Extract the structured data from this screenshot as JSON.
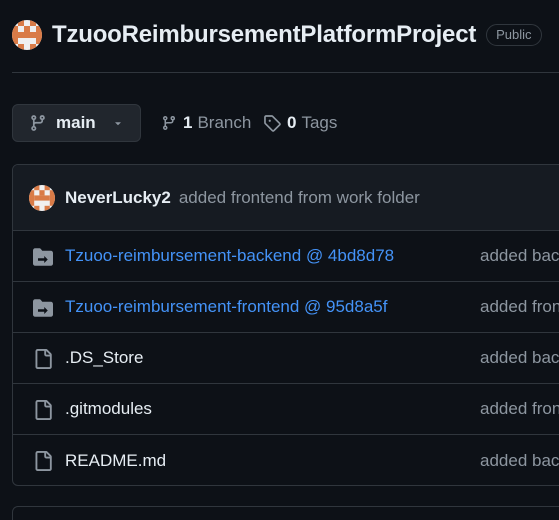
{
  "repo": {
    "name": "TzuooReimbursementPlatformProject",
    "visibility": "Public",
    "avatar_icon": "identicon-avatar"
  },
  "toolbar": {
    "branch_label": "main",
    "branch_count": "1",
    "branch_word": "Branch",
    "tag_count": "0",
    "tag_word": "Tags"
  },
  "latest_commit": {
    "author": "NeverLucky2",
    "message": "added frontend from work folder"
  },
  "files": [
    {
      "name": "Tzuoo-reimbursement-backend @ 4bd8d78",
      "type": "submodule",
      "icon": "submodule-folder-icon",
      "commit": "added bac"
    },
    {
      "name": "Tzuoo-reimbursement-frontend @ 95d8a5f",
      "type": "submodule",
      "icon": "submodule-folder-icon",
      "commit": "added fron"
    },
    {
      "name": ".DS_Store",
      "type": "file",
      "icon": "file-icon",
      "commit": "added bac"
    },
    {
      "name": ".gitmodules",
      "type": "file",
      "icon": "file-icon",
      "commit": "added fron"
    },
    {
      "name": "README.md",
      "type": "file",
      "icon": "file-icon",
      "commit": "added bac"
    }
  ],
  "colors": {
    "background": "#0d1117",
    "border": "#30363d",
    "link": "#4493f8",
    "muted": "#8d96a0",
    "text": "#e6edf3",
    "avatar_accent": "#d97b47"
  }
}
